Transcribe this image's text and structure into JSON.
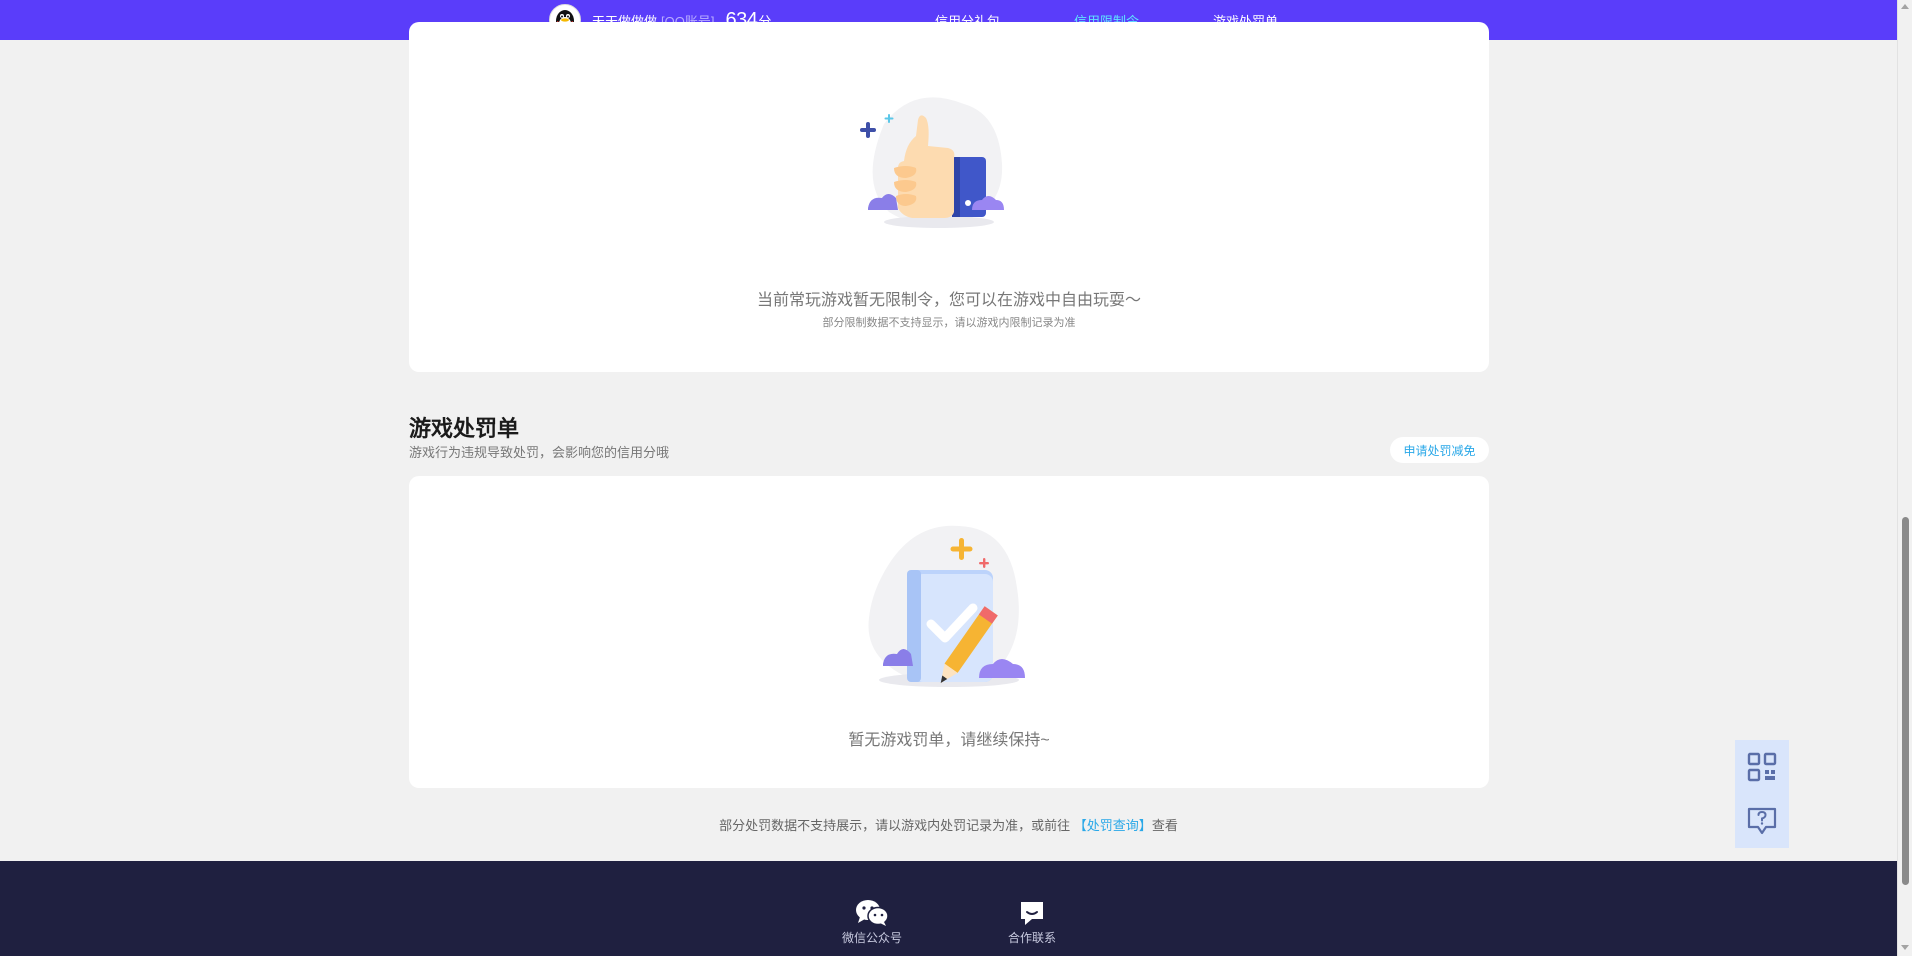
{
  "user": {
    "name": "天天做做做",
    "account_type": "[QQ账号]",
    "score": "634",
    "score_unit": "分"
  },
  "nav": {
    "items": [
      {
        "label": "信用分礼包",
        "active": false
      },
      {
        "label": "信用限制令",
        "active": true
      },
      {
        "label": "游戏处罚单",
        "active": false
      }
    ]
  },
  "restriction": {
    "empty_message": "当前常玩游戏暂无限制令，您可以在游戏中自由玩耍～",
    "empty_note": "部分限制数据不支持显示，请以游戏内限制记录为准"
  },
  "penalty": {
    "title": "游戏处罚单",
    "subtitle": "游戏行为违规导致处罚，会影响您的信用分哦",
    "apply_button": "申请处罚减免",
    "empty_message": "暂无游戏罚单，请继续保持~",
    "note_prefix": "部分处罚数据不支持展示，请以游戏内处罚记录为准，或前往",
    "note_link": "【处罚查询】",
    "note_suffix": "查看"
  },
  "footer": {
    "wechat_label": "微信公众号",
    "contact_label": "合作联系"
  },
  "colors": {
    "topbar": "#5a3dfa",
    "active_nav": "#5fe6ff",
    "link": "#2aa8e8",
    "footer": "#1f2040"
  },
  "icons": [
    "qq-penguin-icon",
    "thumbs-up-illustration",
    "clipboard-pencil-illustration",
    "wechat-icon",
    "chat-bubble-icon",
    "qr-code-icon",
    "help-feedback-icon"
  ]
}
